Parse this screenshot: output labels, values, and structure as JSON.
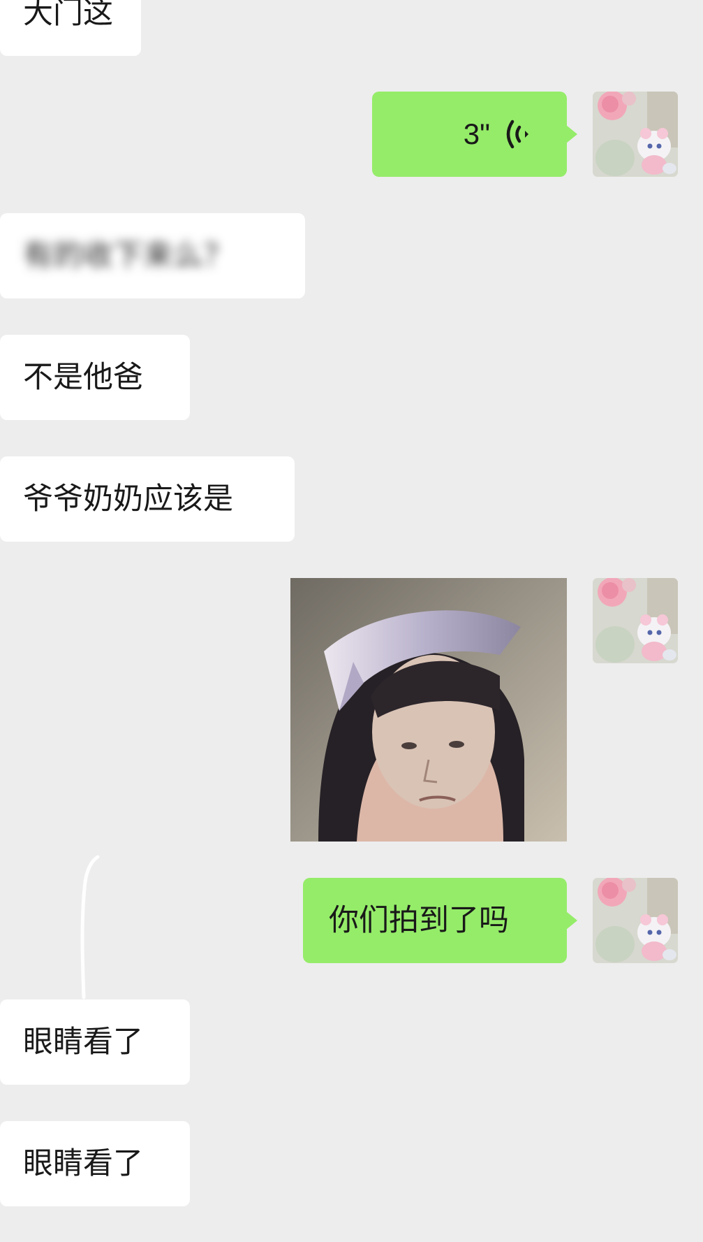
{
  "chat": {
    "messages": [
      {
        "side": "left",
        "type": "text",
        "text": "大门这"
      },
      {
        "side": "right",
        "type": "voice",
        "duration": "3\"",
        "icon": "voice-wave-icon"
      },
      {
        "side": "left",
        "type": "text",
        "text": "有的收下来么？",
        "obscured": true
      },
      {
        "side": "left",
        "type": "text",
        "text": "不是他爸"
      },
      {
        "side": "left",
        "type": "text",
        "text": "爷爷奶奶应该是"
      },
      {
        "side": "right",
        "type": "image",
        "description": "sticker photo"
      },
      {
        "side": "right",
        "type": "text",
        "text": "你们拍到了吗"
      },
      {
        "side": "left",
        "type": "text",
        "text": "眼睛看了"
      },
      {
        "side": "left",
        "type": "text",
        "text": "眼睛看了"
      }
    ]
  },
  "colors": {
    "background": "#ededed",
    "incoming_bubble": "#ffffff",
    "outgoing_bubble": "#95ec69",
    "text": "#191919"
  }
}
